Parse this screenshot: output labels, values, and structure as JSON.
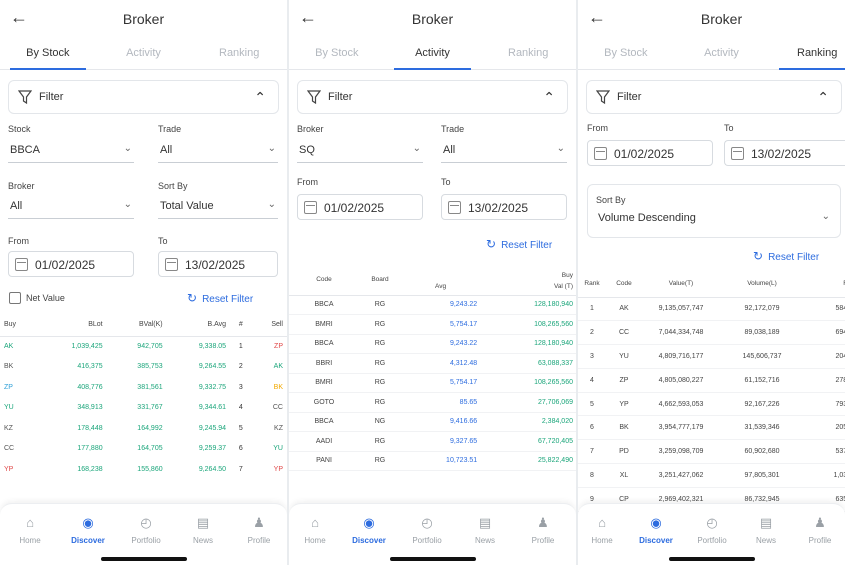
{
  "app": {
    "title": "Broker",
    "back_icon": "arrow-left-icon"
  },
  "tabs": [
    "By Stock",
    "Activity",
    "Ranking"
  ],
  "filter_label": "Filter",
  "reset_label": "Reset Filter",
  "colors": {
    "accent": "#2d6cdf",
    "buy_green": "#1aa57a",
    "sell_red": "#e04848",
    "highlight_yellow": "#f2a900"
  },
  "nav": [
    {
      "label": "Home",
      "icon": "home-icon"
    },
    {
      "label": "Discover",
      "icon": "compass-icon"
    },
    {
      "label": "Portfolio",
      "icon": "pie-chart-icon"
    },
    {
      "label": "News",
      "icon": "newspaper-icon"
    },
    {
      "label": "Profile",
      "icon": "user-icon"
    }
  ],
  "by_stock": {
    "labels": {
      "stock": "Stock",
      "trade": "Trade",
      "broker": "Broker",
      "sort_by": "Sort By",
      "from": "From",
      "to": "To",
      "net_value": "Net Value"
    },
    "values": {
      "stock": "BBCA",
      "trade": "All",
      "broker": "All",
      "sort_by": "Total Value",
      "from": "01/02/2025",
      "to": "13/02/2025"
    },
    "columns": [
      "Buy",
      "BLot",
      "BVal(K)",
      "B.Avg",
      "#",
      "Sell"
    ],
    "rows": [
      [
        "AK",
        "1,039,425",
        "942,705",
        "9,338.05",
        "1",
        "ZP"
      ],
      [
        "BK",
        "416,375",
        "385,753",
        "9,264.55",
        "2",
        "AK"
      ],
      [
        "ZP",
        "408,776",
        "381,561",
        "9,332.75",
        "3",
        "BK"
      ],
      [
        "YU",
        "348,913",
        "331,767",
        "9,344.61",
        "4",
        "CC"
      ],
      [
        "KZ",
        "178,448",
        "164,992",
        "9,245.94",
        "5",
        "KZ"
      ],
      [
        "CC",
        "177,880",
        "164,705",
        "9,259.37",
        "6",
        "YU"
      ],
      [
        "YP",
        "168,238",
        "155,860",
        "9,264.50",
        "7",
        "YP"
      ]
    ]
  },
  "activity": {
    "labels": {
      "broker": "Broker",
      "trade": "Trade",
      "from": "From",
      "to": "To"
    },
    "values": {
      "broker": "SQ",
      "trade": "All",
      "from": "01/02/2025",
      "to": "13/02/2025"
    },
    "columns": {
      "code": "Code",
      "board": "Board",
      "group": "Buy",
      "avg": "Avg",
      "val": "Val (T)"
    },
    "rows": [
      [
        "BBCA",
        "RG",
        "9,243.22",
        "128,180,940"
      ],
      [
        "BMRI",
        "RG",
        "5,754.17",
        "108,265,560"
      ],
      [
        "BBCA",
        "RG",
        "9,243.22",
        "128,180,940"
      ],
      [
        "BBRI",
        "RG",
        "4,312.48",
        "63,088,337"
      ],
      [
        "BMRI",
        "RG",
        "5,754.17",
        "108,265,560"
      ],
      [
        "GOTO",
        "RG",
        "85.65",
        "27,706,069"
      ],
      [
        "BBCA",
        "NG",
        "9,416.66",
        "2,384,020"
      ],
      [
        "AADI",
        "RG",
        "9,327.65",
        "67,720,405"
      ],
      [
        "PANI",
        "RG",
        "10,723.51",
        "25,822,490"
      ]
    ]
  },
  "ranking": {
    "labels": {
      "from": "From",
      "to": "To",
      "sort_by": "Sort By"
    },
    "values": {
      "from": "01/02/2025",
      "to": "13/02/2025",
      "sort_by": "Volume Descending"
    },
    "columns": [
      "Rank",
      "Code",
      "Value(T)",
      "Volume(L)",
      "Fre"
    ],
    "rows": [
      [
        "1",
        "AK",
        "9,135,057,747",
        "92,172,079",
        "584,4"
      ],
      [
        "2",
        "CC",
        "7,044,334,748",
        "89,038,189",
        "694,7"
      ],
      [
        "3",
        "YU",
        "4,809,716,177",
        "145,606,737",
        "204,1"
      ],
      [
        "4",
        "ZP",
        "4,805,080,227",
        "61,152,716",
        "278,7"
      ],
      [
        "5",
        "YP",
        "4,662,593,053",
        "92,167,226",
        "793,4"
      ],
      [
        "6",
        "BK",
        "3,954,777,179",
        "31,539,346",
        "205,1"
      ],
      [
        "7",
        "PD",
        "3,259,098,709",
        "60,902,680",
        "537,0"
      ],
      [
        "8",
        "XL",
        "3,251,427,062",
        "97,805,301",
        "1,030,"
      ],
      [
        "9",
        "CP",
        "2,969,402,321",
        "86,732,945",
        "635,2"
      ]
    ]
  }
}
